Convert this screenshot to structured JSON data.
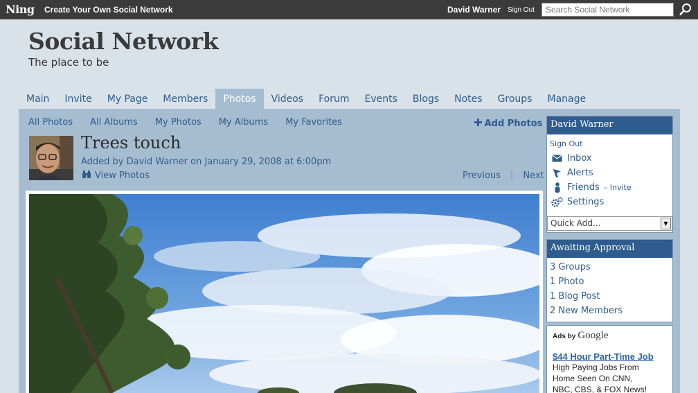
{
  "topbar": {
    "logo": "Ning",
    "create_link": "Create Your Own Social Network",
    "user_name": "David Warner",
    "sign_out": "Sign Out",
    "search_placeholder": "Search Social Network"
  },
  "header": {
    "title": "Social Network",
    "tagline": "The place to be"
  },
  "nav": {
    "tabs": [
      {
        "label": "Main"
      },
      {
        "label": "Invite"
      },
      {
        "label": "My Page"
      },
      {
        "label": "Members"
      },
      {
        "label": "Photos"
      },
      {
        "label": "Videos"
      },
      {
        "label": "Forum"
      },
      {
        "label": "Events"
      },
      {
        "label": "Blogs"
      },
      {
        "label": "Notes"
      },
      {
        "label": "Groups"
      },
      {
        "label": "Manage"
      }
    ],
    "active": "Photos"
  },
  "subnav": {
    "items": [
      "All Photos",
      "All Albums",
      "My Photos",
      "My Albums",
      "My Favorites"
    ],
    "add_photos": "Add Photos"
  },
  "photo": {
    "title": "Trees touch",
    "meta": "Added by David Warner on January 29, 2008 at 6:00pm",
    "view_photos": "View Photos",
    "previous": "Previous",
    "separator": "|",
    "next": "Next"
  },
  "sidebar": {
    "user_box": {
      "name": "David Warner",
      "sign_out": "Sign Out",
      "links": [
        {
          "label": "Inbox",
          "icon": "envelope-icon"
        },
        {
          "label": "Alerts",
          "icon": "flag-icon"
        },
        {
          "label": "Friends",
          "icon": "person-icon",
          "extra": "– Invite"
        },
        {
          "label": "Settings",
          "icon": "gear-icon"
        }
      ],
      "quick_add": "Quick Add..."
    },
    "approval": {
      "title": "Awaiting Approval",
      "items": [
        "3 Groups",
        "1 Photo",
        "1 Blog Post",
        "2 New Members"
      ]
    },
    "ads": {
      "ads_by": "Ads by",
      "google": "Google",
      "link": "$44 Hour Part-Time Job",
      "text_lines": [
        "High Paying Jobs From",
        "Home Seen On CNN,",
        "NBC, CBS, & FOX News!"
      ]
    }
  },
  "colors": {
    "topbar": "#3b3b3b",
    "page_bg": "#d9e2e8",
    "panel": "#a6bdd1",
    "link": "#2f5c8f",
    "box_header": "#2f5c8f"
  }
}
